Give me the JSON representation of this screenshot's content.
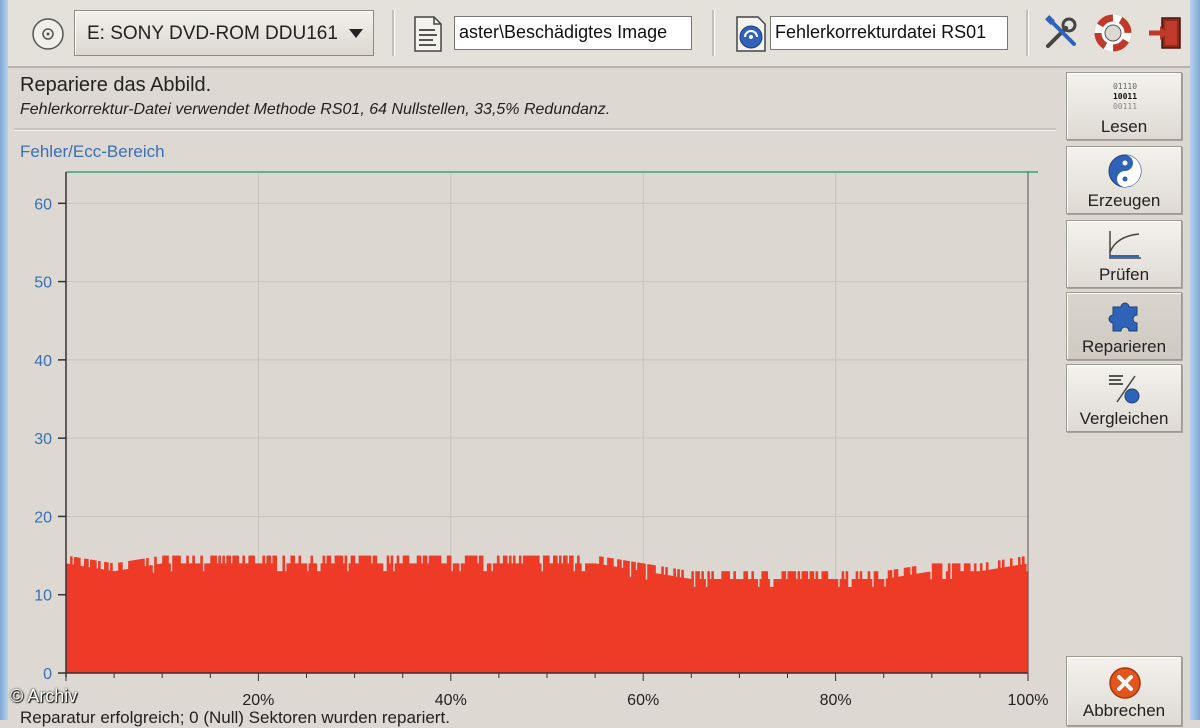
{
  "toolbar": {
    "drive_select_value": "E: SONY DVD-ROM DDU161",
    "image_file_value": "aster\\Beschädigtes Image",
    "ecc_file_value": "Fehlerkorrekturdatei RS01"
  },
  "header": {
    "title": "Repariere das Abbild.",
    "subtitle": "Fehlerkorrektur-Datei verwendet Methode RS01, 64 Nullstellen, 33,5% Redundanz."
  },
  "graph": {
    "label": "Fehler/Ecc-Bereich"
  },
  "sidebar": {
    "items": [
      {
        "label": "Lesen",
        "icon": "binary-read-icon"
      },
      {
        "label": "Erzeugen",
        "icon": "yin-yang-icon"
      },
      {
        "label": "Prüfen",
        "icon": "curve-chart-icon"
      },
      {
        "label": "Reparieren",
        "icon": "puzzle-icon"
      },
      {
        "label": "Vergleichen",
        "icon": "compare-icon"
      }
    ],
    "cancel_label": "Abbrechen"
  },
  "status": {
    "text": "Reparatur erfolgreich; 0 (Null) Sektoren wurden repariert."
  },
  "watermark": "© Archiv",
  "colors": {
    "bars": "#ee3b26",
    "ecc_line": "#5fb28e",
    "axis_label": "#3a6fb5"
  },
  "chart_data": {
    "type": "bar",
    "xlabel": "",
    "ylabel": "",
    "x_ticks": [
      "20%",
      "40%",
      "60%",
      "80%",
      "100%"
    ],
    "y_ticks": [
      0,
      10,
      20,
      30,
      40,
      50,
      60
    ],
    "ylim": [
      0,
      64
    ],
    "xlim": [
      0,
      100
    ],
    "ecc_threshold": 64,
    "grid": true,
    "x": [
      0,
      5,
      10,
      15,
      20,
      25,
      30,
      35,
      40,
      45,
      50,
      55,
      60,
      65,
      70,
      75,
      80,
      85,
      90,
      95,
      100
    ],
    "values": [
      14,
      13,
      14,
      14,
      14,
      14,
      14,
      14,
      14,
      14,
      14,
      14,
      13,
      12,
      12,
      12,
      12,
      12,
      13,
      13,
      14
    ]
  }
}
